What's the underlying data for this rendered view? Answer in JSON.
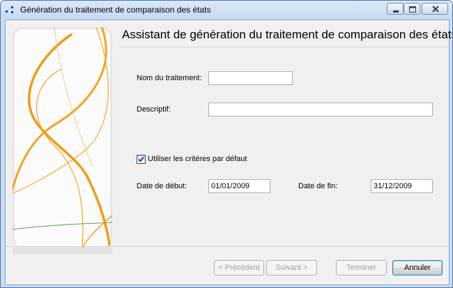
{
  "window": {
    "title": "Génération du traitement de comparaison des états"
  },
  "wizard": {
    "header_title": "Assistant de génération du traitement de comparaison des états"
  },
  "form": {
    "name_label": "Nom du traitement:",
    "name_value": "",
    "description_label": "Descriptif:",
    "description_value": "",
    "use_default_criteria_label": "Utiliser les critères par défaut",
    "use_default_criteria_checked": true,
    "start_date_label": "Date de début:",
    "start_date_value": "01/01/2009",
    "end_date_label": "Date de fin:",
    "end_date_value": "31/12/2009"
  },
  "buttons": {
    "previous": "< Précédent",
    "next": "Suivant >",
    "finish": "Terminer",
    "cancel": "Annuler"
  },
  "colors": {
    "orange_accent": "#f5a21d",
    "titlebar": "#c9dcf3"
  }
}
